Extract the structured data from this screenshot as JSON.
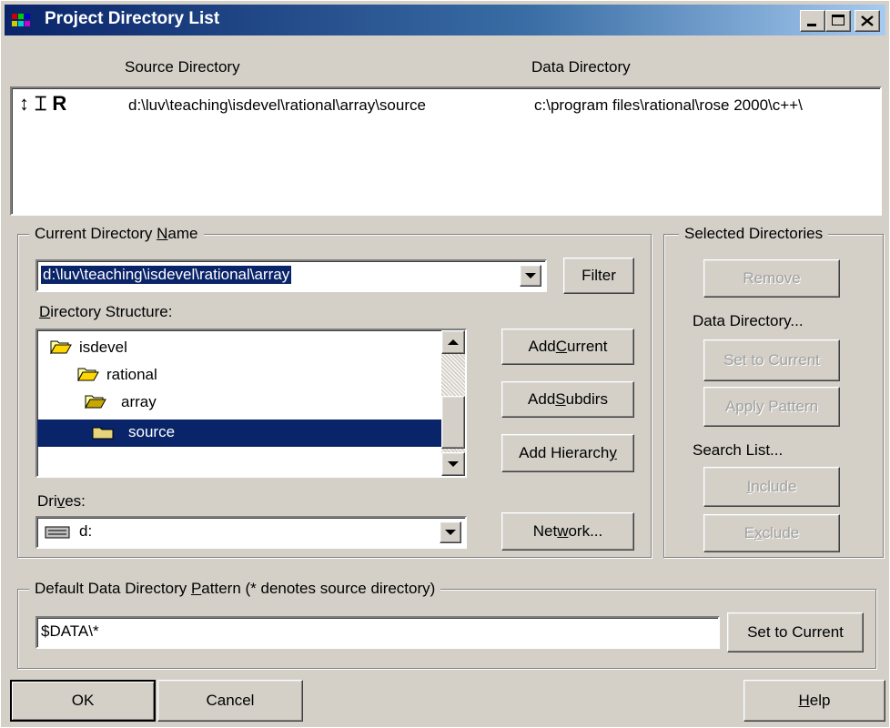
{
  "window": {
    "title": "Project Directory List"
  },
  "colors": {
    "titlebar": "#0a246a",
    "selection": "#0a246a",
    "face": "#d4d0c8"
  },
  "list": {
    "col_source": "Source Directory",
    "col_data": "Data Directory",
    "rows": [
      {
        "icons": "↕ ⌶ R",
        "source": "d:\\luv\\teaching\\isdevel\\rational\\array\\source",
        "data": "c:\\program files\\rational\\rose 2000\\c++\\"
      }
    ]
  },
  "current_dir": {
    "group_label_pre": "Current Directory ",
    "group_label_u": "N",
    "group_label_post": "ame",
    "value": "d:\\luv\\teaching\\isdevel\\rational\\array",
    "filter_label": "Filter",
    "structure_label_u": "D",
    "structure_label_post": "irectory Structure:",
    "tree": [
      {
        "name": "isdevel",
        "selected": false
      },
      {
        "name": "rational",
        "selected": false
      },
      {
        "name": "array",
        "selected": false
      },
      {
        "name": "source",
        "selected": true
      }
    ],
    "drives_label_pre": "Dri",
    "drives_label_u": "v",
    "drives_label_post": "es:",
    "drive_value": "d:",
    "add_current_pre": "Add ",
    "add_current_u": "C",
    "add_current_post": "urrent",
    "add_subdirs_pre": "Add ",
    "add_subdirs_u": "S",
    "add_subdirs_post": "ubdirs",
    "add_hierarchy_pre": "Add Hierarch",
    "add_hierarchy_u": "y",
    "add_hierarchy_post": "",
    "network_pre": "Net",
    "network_u": "w",
    "network_post": "ork..."
  },
  "selected_dirs": {
    "group_label": "Selected Directories",
    "remove_label": "Remove",
    "data_dir_label": "Data Directory...",
    "set_to_current": "Set to Current",
    "apply_pattern": "Apply Pattern",
    "search_list_label": "Search List...",
    "include_u": "I",
    "include_post": "nclude",
    "exclude_pre": "E",
    "exclude_u": "x",
    "exclude_post": "clude"
  },
  "pattern": {
    "group_label_pre": "Default Data Directory ",
    "group_label_u": "P",
    "group_label_post": "attern  (* denotes source directory)",
    "value": "$DATA\\*",
    "set_to_current": "Set to Current"
  },
  "footer": {
    "ok": "OK",
    "cancel": "Cancel",
    "help_u": "H",
    "help_post": "elp"
  }
}
